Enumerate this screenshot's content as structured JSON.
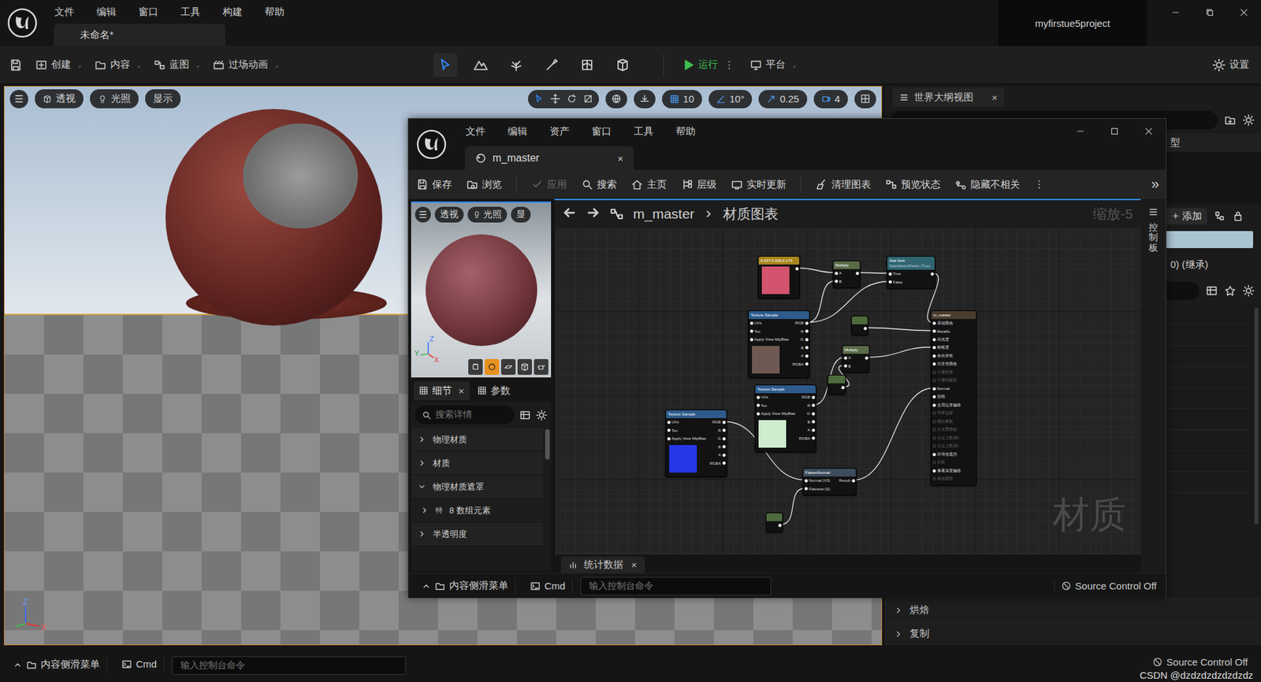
{
  "window": {
    "project": "myfirstue5project",
    "menu": [
      "文件",
      "编辑",
      "窗口",
      "工具",
      "构建",
      "帮助"
    ],
    "level_tab": "未命名*"
  },
  "toolbar": {
    "items": [
      "创建",
      "内容",
      "蓝图",
      "过场动画"
    ],
    "modes": [
      {
        "selected": true
      },
      {
        "selected": false
      },
      {
        "selected": false
      },
      {
        "selected": false
      },
      {
        "selected": false
      },
      {
        "selected": false
      }
    ],
    "run": "运行",
    "run_more": "⋮",
    "platform": "平台",
    "settings": "设置"
  },
  "viewport": {
    "menu": "☰",
    "view": "透视",
    "lighting": "光照",
    "show": "显示",
    "snaps": [
      "10",
      "10°",
      "0.25",
      "4"
    ],
    "axes": [
      "Z",
      "X"
    ]
  },
  "outliner": {
    "title": "世界大纲视图",
    "close": "×",
    "column_fragment": "型"
  },
  "details": {
    "add": "添加",
    "inherited": "0) (继承)",
    "sections": [
      {
        "label": "烘焙",
        "expanded": false
      },
      {
        "label": "复制",
        "expanded": false
      }
    ]
  },
  "status_bar": {
    "content_drawer": "内容侧滑菜单",
    "cmd": "Cmd",
    "console_placeholder": "输入控制台命令",
    "source_control": "Source Control Off"
  },
  "watermark": "CSDN @dzdzdzdzdzdzdz",
  "material_editor": {
    "menu": [
      "文件",
      "编辑",
      "资产",
      "窗口",
      "工具",
      "帮助"
    ],
    "tab": {
      "label": "m_master",
      "close": "×"
    },
    "toolbar": [
      {
        "label": "保存",
        "disabled": false
      },
      {
        "label": "浏览",
        "disabled": false
      },
      {
        "label": "应用",
        "disabled": true
      },
      {
        "label": "搜索",
        "disabled": false
      },
      {
        "label": "主页",
        "disabled": false
      },
      {
        "label": "层级",
        "disabled": false
      },
      {
        "label": "实时更新",
        "disabled": false
      },
      {
        "label": "清理图表",
        "disabled": false
      },
      {
        "label": "预览状态",
        "disabled": false
      },
      {
        "label": "隐藏不相关",
        "disabled": false
      }
    ],
    "toolbar_more": "⋮",
    "toolbar_overflow": "»",
    "preview": {
      "menu": "☰",
      "view": "透视",
      "lighting": "光照",
      "show": "显",
      "shapes": [
        {
          "selected": false
        },
        {
          "selected": true
        },
        {
          "selected": false
        },
        {
          "selected": false
        },
        {
          "selected": false
        }
      ],
      "axes": [
        "Z",
        "Y",
        "X"
      ]
    },
    "details_tabs": [
      {
        "label": "细节",
        "selected": true,
        "closable": true
      },
      {
        "label": "参数",
        "selected": false,
        "closable": false
      }
    ],
    "close": "×",
    "details_search": "搜索详情",
    "details_rows": [
      {
        "kind": "category",
        "label": "物理材质",
        "expanded": false
      },
      {
        "kind": "category",
        "label": "材质",
        "expanded": false
      },
      {
        "kind": "category",
        "label": "物理材质遮罩",
        "expanded": true
      },
      {
        "kind": "array",
        "prefix": "特",
        "label": "8 数组元素",
        "expanded": false
      },
      {
        "kind": "category",
        "label": "半透明度",
        "expanded": false
      }
    ],
    "breadcrumb": {
      "root": "m_master",
      "current": "材质图表"
    },
    "zoom": "缩放-5",
    "graph_watermark": "材质",
    "palette": "控制板",
    "stats_tab": {
      "label": "统计数据",
      "close": "×"
    },
    "status_bar": {
      "content_drawer": "内容侧滑菜单",
      "cmd": "Cmd",
      "console_placeholder": "输入控制台命令",
      "source_control": "Source Control Off"
    },
    "graph": {
      "nodes": [
        {
          "kind": "vector",
          "title": "0.337,0.106,0.173",
          "bare_output": true,
          "color": "#d2546e"
        },
        {
          "kind": "math",
          "title": "Multiply",
          "inputs": [
            "A",
            "B"
          ],
          "bare_output": true
        },
        {
          "kind": "switch",
          "title": "Stat Swit",
          "subtitle": "StaticSwitchParam (True)",
          "inputs": [
            "True",
            "False"
          ],
          "bare_output": true
        },
        {
          "kind": "texture",
          "title": "Texture Sample",
          "inputs": [
            "UVs",
            "Tex",
            "Apply View MipBias"
          ],
          "outputs": [
            "RGB",
            "R",
            "G",
            "B",
            "A",
            "RGBA"
          ],
          "color": "#6e5a52"
        },
        {
          "kind": "const",
          "bare_output": true
        },
        {
          "kind": "math",
          "title": "Multiply",
          "inputs": [
            "A",
            "B"
          ],
          "bare_output": true
        },
        {
          "kind": "const",
          "bare_output": true
        },
        {
          "kind": "texture",
          "title": "Texture Sample",
          "inputs": [
            "UVs",
            "Tex",
            "Apply View MipBias"
          ],
          "outputs": [
            "RGB",
            "R",
            "G",
            "B",
            "A",
            "RGBA"
          ],
          "color": "#cfeccf"
        },
        {
          "kind": "texture",
          "title": "Texture Sample",
          "inputs": [
            "UVs",
            "Tex",
            "Apply View MipBias"
          ],
          "outputs": [
            "RGB",
            "R",
            "G",
            "B",
            "A",
            "RGBA"
          ],
          "color": "#2438e8"
        },
        {
          "kind": "function",
          "title": "FlattenNormal",
          "inputs": [
            "Normal (V3)",
            "Flatness (S)"
          ],
          "outputs": [
            "Result"
          ]
        },
        {
          "kind": "const",
          "bare_output": true
        },
        {
          "kind": "result",
          "title": "m_master",
          "inputs": [
            {
              "label": "基础颜色",
              "disabled": false
            },
            {
              "label": "Metallic",
              "disabled": false
            },
            {
              "label": "高光度",
              "disabled": false
            },
            {
              "label": "粗糙度",
              "disabled": false
            },
            {
              "label": "各向异性",
              "disabled": false
            },
            {
              "label": "自发光颜色",
              "disabled": false
            },
            {
              "label": "不透明度",
              "disabled": true
            },
            {
              "label": "不透明蒙版",
              "disabled": true
            },
            {
              "label": "Normal",
              "disabled": false
            },
            {
              "label": "切线",
              "disabled": false
            },
            {
              "label": "全局位置偏移",
              "disabled": false
            },
            {
              "label": "世界位移",
              "disabled": true
            },
            {
              "label": "细分乘数",
              "disabled": true
            },
            {
              "label": "次表面颜色",
              "disabled": true
            },
            {
              "label": "自定义数据0",
              "disabled": true
            },
            {
              "label": "自定义数据1",
              "disabled": true
            },
            {
              "label": "环境光遮挡",
              "disabled": false
            },
            {
              "label": "折射",
              "disabled": true
            },
            {
              "label": "像素深度偏移",
              "disabled": false
            },
            {
              "label": "着色模型",
              "disabled": true
            }
          ]
        }
      ],
      "edges": [
        {
          "from": [
            0,
            0
          ],
          "to": [
            1,
            0
          ]
        },
        {
          "from": [
            3,
            0
          ],
          "to": [
            1,
            1
          ]
        },
        {
          "from": [
            1,
            0
          ],
          "to": [
            2,
            0
          ]
        },
        {
          "from": [
            3,
            0
          ],
          "to": [
            2,
            1
          ]
        },
        {
          "from": [
            2,
            0
          ],
          "to": [
            11,
            0
          ]
        },
        {
          "from": [
            4,
            0
          ],
          "to": [
            11,
            1
          ]
        },
        {
          "from": [
            5,
            0
          ],
          "to": [
            11,
            3
          ]
        },
        {
          "from": [
            7,
            1
          ],
          "to": [
            5,
            0
          ]
        },
        {
          "from": [
            6,
            0
          ],
          "to": [
            5,
            1
          ]
        },
        {
          "from": [
            8,
            0
          ],
          "to": [
            9,
            0
          ]
        },
        {
          "from": [
            10,
            0
          ],
          "to": [
            9,
            1
          ]
        },
        {
          "from": [
            9,
            0
          ],
          "to": [
            11,
            8
          ]
        }
      ]
    }
  }
}
